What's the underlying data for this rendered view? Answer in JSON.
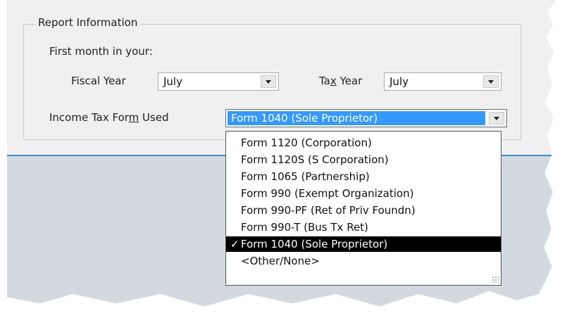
{
  "report_info": {
    "title": "Report Information",
    "first_month_label": "First month in your:",
    "fiscal_year": {
      "label": "Fiscal Year",
      "value": "July"
    },
    "tax_year": {
      "label_pre": "Ta",
      "label_u": "x",
      "label_post": " Year",
      "value": "July"
    },
    "income_tax_form": {
      "label_pre": "Income Tax For",
      "label_u": "m",
      "label_post": " Used",
      "value": "Form 1040 (Sole Proprietor)"
    }
  },
  "dropdown": {
    "options": [
      "Form 1120 (Corporation)",
      "Form 1120S (S Corporation)",
      "Form 1065 (Partnership)",
      "Form 990 (Exempt Organization)",
      "Form 990-PF (Ret of Priv Foundn)",
      "Form 990-T (Bus Tx Ret)",
      "Form 1040 (Sole Proprietor)",
      "<Other/None>"
    ],
    "selected_check": "✓"
  }
}
